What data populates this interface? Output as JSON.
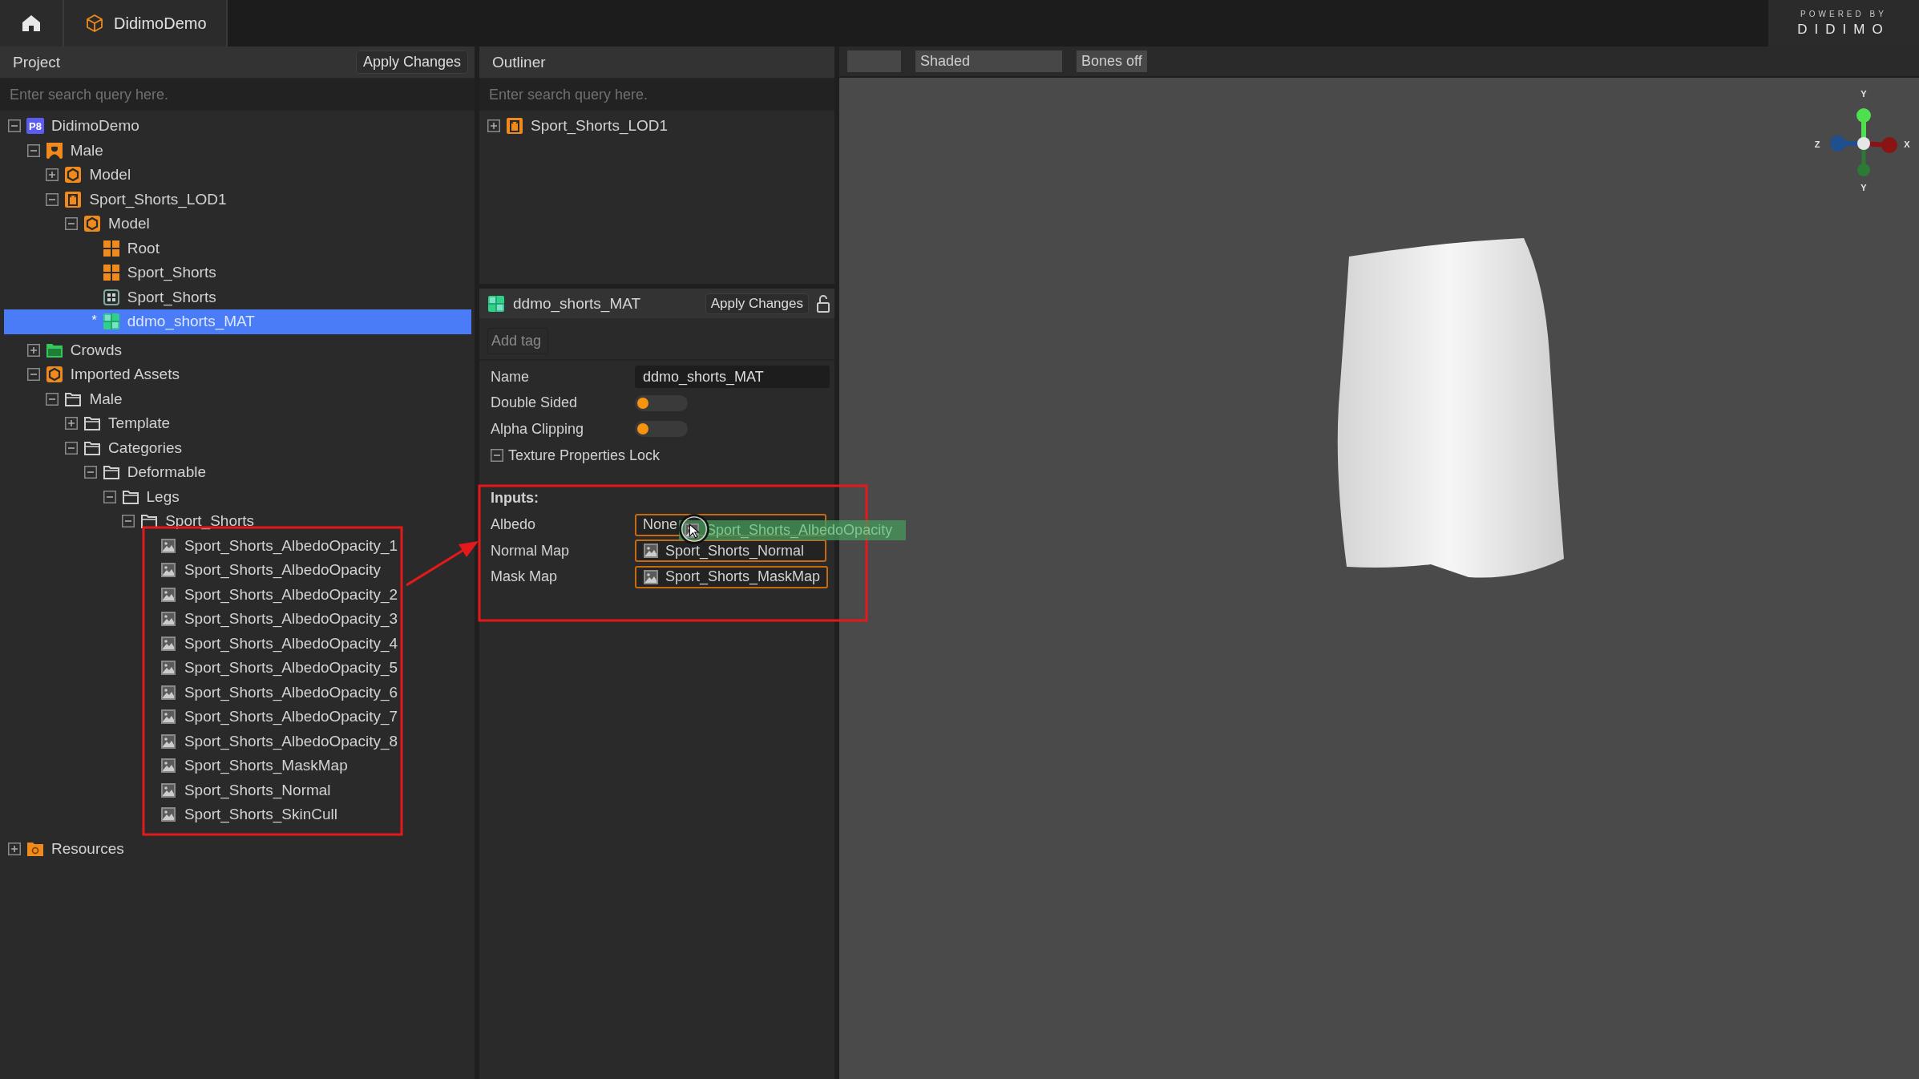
{
  "top_bar": {
    "tabs": [
      {
        "kind": "home"
      },
      {
        "kind": "project",
        "label": "DidimoDemo"
      }
    ],
    "branding": {
      "caption": "POWERED BY",
      "logo": "DIDIMO"
    }
  },
  "project_panel": {
    "title": "Project",
    "apply_button": "Apply Changes",
    "search": {
      "placeholder": "Enter search query here."
    },
    "tree": [
      {
        "label": "DidimoDemo",
        "kind": "project",
        "badge": "P8",
        "expanded": true,
        "selected": false,
        "children": [
          {
            "label": "Male",
            "kind": "person",
            "expanded": true,
            "selected": false,
            "children": [
              {
                "label": "Model",
                "kind": "model",
                "expanded": false,
                "selected": false
              },
              {
                "label": "Sport_Shorts_LOD1",
                "kind": "garment",
                "expanded": true,
                "selected": false,
                "children": [
                  {
                    "label": "Model",
                    "kind": "model",
                    "expanded": true,
                    "selected": false,
                    "children": [
                      {
                        "label": "Root",
                        "kind": "joints",
                        "selected": false
                      },
                      {
                        "label": "Sport_Shorts",
                        "kind": "joints",
                        "selected": false
                      },
                      {
                        "label": "Sport_Shorts",
                        "kind": "mesh",
                        "selected": false
                      },
                      {
                        "label": "ddmo_shorts_MAT",
                        "kind": "material",
                        "marker": "*",
                        "selected": true
                      }
                    ]
                  }
                ]
              }
            ]
          },
          {
            "label": "Crowds",
            "kind": "crowds",
            "expanded": false,
            "selected": false
          },
          {
            "label": "Imported Assets",
            "kind": "model",
            "expanded": true,
            "selected": false,
            "children": [
              {
                "label": "Male",
                "kind": "folder",
                "expanded": true,
                "selected": false,
                "children": [
                  {
                    "label": "Template",
                    "kind": "folder",
                    "expanded": false,
                    "selected": false
                  },
                  {
                    "label": "Categories",
                    "kind": "folder",
                    "expanded": true,
                    "selected": false,
                    "children": [
                      {
                        "label": "Deformable",
                        "kind": "folder",
                        "expanded": true,
                        "selected": false,
                        "children": [
                          {
                            "label": "Legs",
                            "kind": "folder",
                            "expanded": true,
                            "selected": false,
                            "children": [
                              {
                                "label": "Sport_Shorts",
                                "kind": "folder",
                                "expanded": true,
                                "selected": false,
                                "children": [
                                  {
                                    "label": "Sport_Shorts_AlbedoOpacity_1",
                                    "kind": "texture",
                                    "selected": false
                                  },
                                  {
                                    "label": "Sport_Shorts_AlbedoOpacity",
                                    "kind": "texture",
                                    "selected": false
                                  },
                                  {
                                    "label": "Sport_Shorts_AlbedoOpacity_2",
                                    "kind": "texture",
                                    "selected": false
                                  },
                                  {
                                    "label": "Sport_Shorts_AlbedoOpacity_3",
                                    "kind": "texture",
                                    "selected": false
                                  },
                                  {
                                    "label": "Sport_Shorts_AlbedoOpacity_4",
                                    "kind": "texture",
                                    "selected": false
                                  },
                                  {
                                    "label": "Sport_Shorts_AlbedoOpacity_5",
                                    "kind": "texture",
                                    "selected": false
                                  },
                                  {
                                    "label": "Sport_Shorts_AlbedoOpacity_6",
                                    "kind": "texture",
                                    "selected": false
                                  },
                                  {
                                    "label": "Sport_Shorts_AlbedoOpacity_7",
                                    "kind": "texture",
                                    "selected": false
                                  },
                                  {
                                    "label": "Sport_Shorts_AlbedoOpacity_8",
                                    "kind": "texture",
                                    "selected": false
                                  },
                                  {
                                    "label": "Sport_Shorts_MaskMap",
                                    "kind": "texture",
                                    "selected": false
                                  },
                                  {
                                    "label": "Sport_Shorts_Normal",
                                    "kind": "texture",
                                    "selected": false
                                  },
                                  {
                                    "label": "Sport_Shorts_SkinCull",
                                    "kind": "texture",
                                    "selected": false
                                  }
                                ]
                              }
                            ]
                          }
                        ]
                      }
                    ]
                  }
                ]
              }
            ]
          }
        ]
      },
      {
        "label": "Resources",
        "kind": "resources",
        "expanded": false,
        "selected": false
      }
    ]
  },
  "outliner": {
    "title": "Outliner",
    "search": {
      "placeholder": "Enter search query here."
    },
    "tree": [
      {
        "label": "Sport_Shorts_LOD1",
        "kind": "garment",
        "expanded": false,
        "selected": false
      }
    ]
  },
  "material_panel": {
    "title": "ddmo_shorts_MAT",
    "apply_button": "Apply Changes",
    "locked": false,
    "tag_field": {
      "placeholder": "Add tag"
    },
    "properties": [
      {
        "kind": "text",
        "label": "Name",
        "value": "ddmo_shorts_MAT"
      },
      {
        "kind": "toggle",
        "label": "Double Sided",
        "on": false
      },
      {
        "kind": "toggle",
        "label": "Alpha Clipping",
        "on": false
      }
    ],
    "texture_lock": {
      "label": "Texture Properties Lock",
      "expanded": true
    },
    "inputs": {
      "title": "Inputs:",
      "slots": [
        {
          "label": "Albedo",
          "value": "None",
          "assigned": false
        },
        {
          "label": "Normal Map",
          "value": "Sport_Shorts_Normal",
          "assigned": true
        },
        {
          "label": "Mask Map",
          "value": "Sport_Shorts_MaskMap",
          "assigned": true
        }
      ]
    }
  },
  "drag_item": {
    "label": "Sport_Shorts_AlbedoOpacity"
  },
  "viewport": {
    "toolbar": [
      {
        "kind": "blank"
      },
      {
        "kind": "dropdown",
        "label": "Shaded"
      },
      {
        "kind": "button",
        "label": "Bones off"
      }
    ],
    "gizmo": {
      "labels": [
        "Y",
        "Z",
        "X",
        "Y"
      ]
    }
  }
}
